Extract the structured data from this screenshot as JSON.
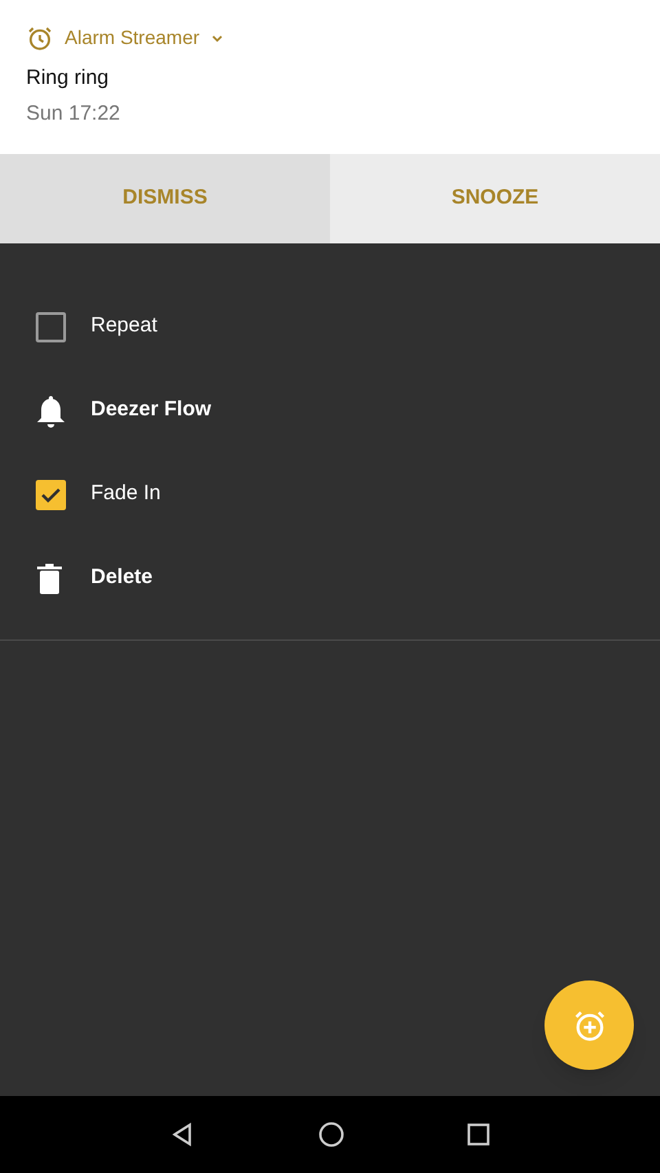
{
  "notification": {
    "app": "Alarm Streamer",
    "title": "Ring ring",
    "time": "Sun 17:22",
    "actions": [
      {
        "label": "DISMISS",
        "selected": true
      },
      {
        "label": "SNOOZE",
        "selected": false
      }
    ]
  },
  "alarm_options": [
    {
      "kind": "checkbox",
      "label": "Repeat",
      "checked": false
    },
    {
      "kind": "ringtone",
      "label": "Deezer Flow"
    },
    {
      "kind": "checkbox",
      "label": "Fade In",
      "checked": true
    },
    {
      "kind": "delete",
      "label": "Delete"
    }
  ]
}
